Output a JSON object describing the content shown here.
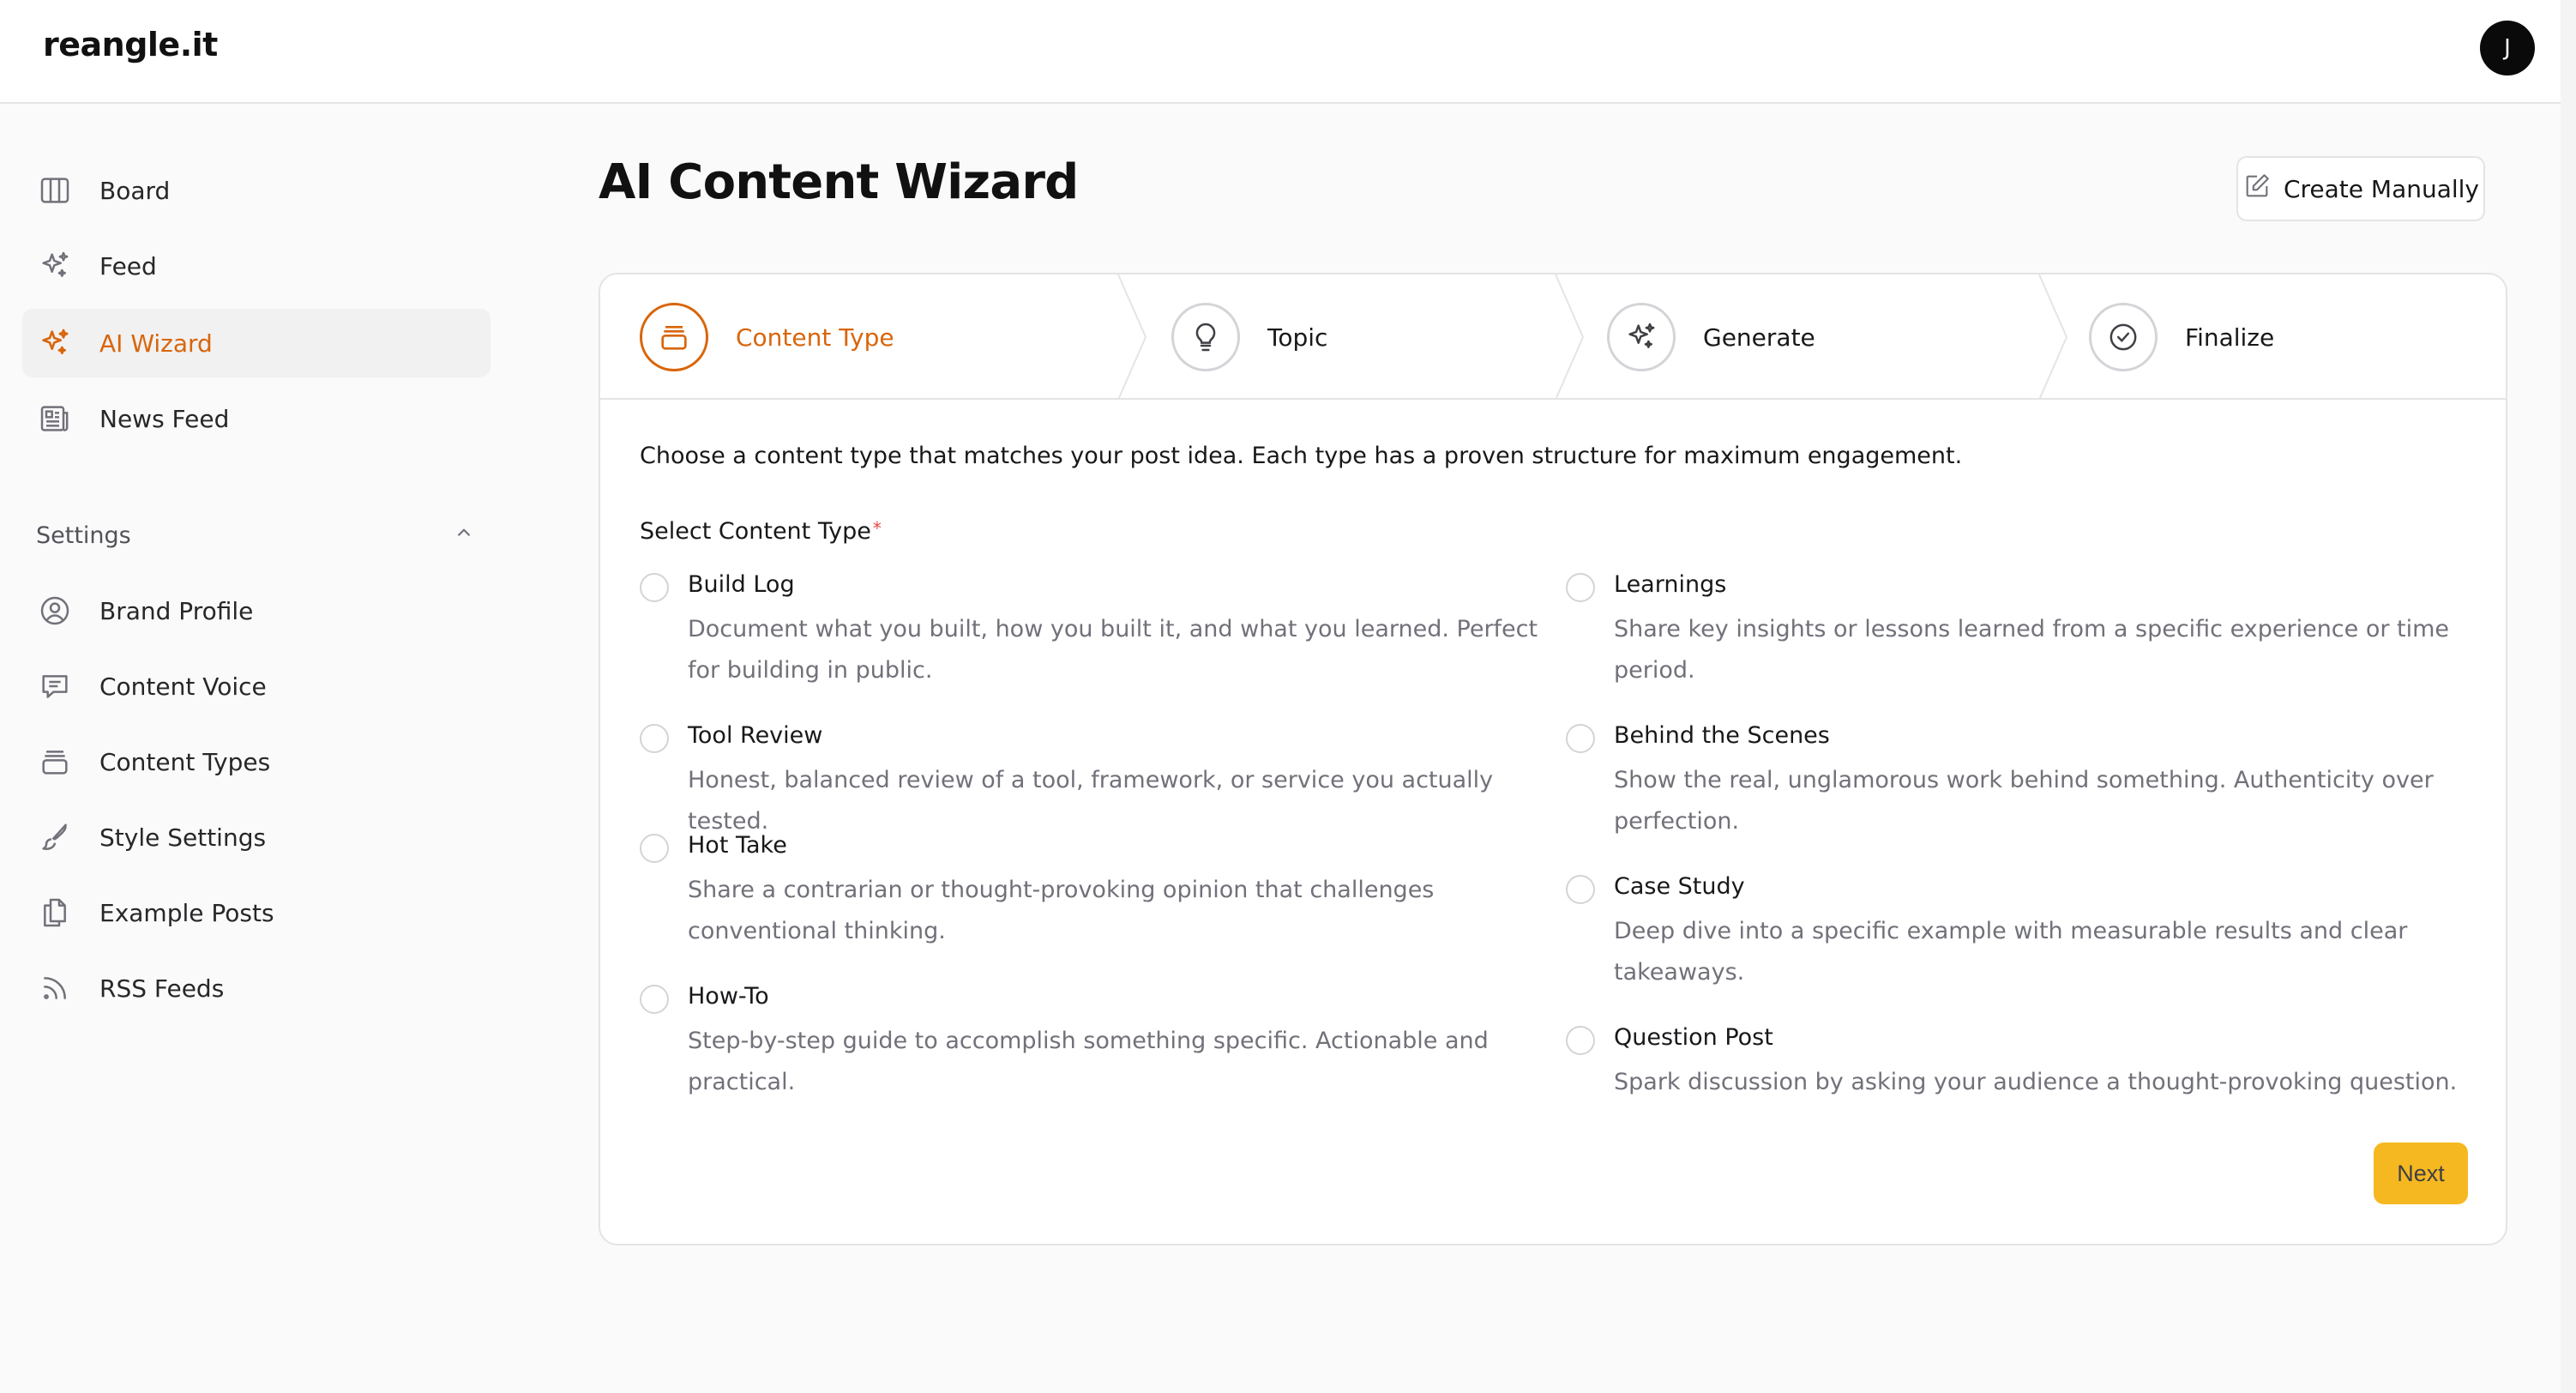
{
  "app": {
    "logo": "reangle.it",
    "user_initial": "J"
  },
  "sidebar": {
    "items": [
      {
        "label": "Board",
        "icon": "board-icon"
      },
      {
        "label": "Feed",
        "icon": "sparkles-icon"
      },
      {
        "label": "AI Wizard",
        "icon": "sparkles-icon",
        "active": true
      },
      {
        "label": "News Feed",
        "icon": "newspaper-icon"
      }
    ],
    "settings_label": "Settings",
    "settings_items": [
      {
        "label": "Brand Profile",
        "icon": "user-circle-icon"
      },
      {
        "label": "Content Voice",
        "icon": "message-icon"
      },
      {
        "label": "Content Types",
        "icon": "archive-icon"
      },
      {
        "label": "Style Settings",
        "icon": "brush-icon"
      },
      {
        "label": "Example Posts",
        "icon": "files-icon"
      },
      {
        "label": "RSS Feeds",
        "icon": "rss-icon"
      }
    ]
  },
  "main": {
    "title": "AI Content Wizard",
    "create_manually": "Create Manually",
    "steps": [
      {
        "label": "Content Type",
        "icon": "archive-icon",
        "active": true
      },
      {
        "label": "Topic",
        "icon": "lightbulb-icon"
      },
      {
        "label": "Generate",
        "icon": "sparkles-icon"
      },
      {
        "label": "Finalize",
        "icon": "check-circle-icon"
      }
    ],
    "intro": "Choose a content type that matches your post idea. Each type has a proven structure for maximum engagement.",
    "field_label": "Select Content Type",
    "required_mark": "*",
    "options": [
      {
        "title": "Build Log",
        "desc": "Document what you built, how you built it, and what you learned. Perfect for building in public."
      },
      {
        "title": "Learnings",
        "desc": "Share key insights or lessons learned from a specific experience or time period."
      },
      {
        "title": "Tool Review",
        "desc": "Honest, balanced review of a tool, framework, or service you actually tested."
      },
      {
        "title": "Behind the Scenes",
        "desc": "Show the real, unglamorous work behind something. Authenticity over perfection."
      },
      {
        "title": "Hot Take",
        "desc": "Share a contrarian or thought-provoking opinion that challenges conventional thinking."
      },
      {
        "title": "Case Study",
        "desc": "Deep dive into a specific example with measurable results and clear takeaways."
      },
      {
        "title": "How-To",
        "desc": "Step-by-step guide to accomplish something specific. Actionable and practical."
      },
      {
        "title": "Question Post",
        "desc": "Spark discussion by asking your audience a thought-provoking question."
      }
    ],
    "next_label": "Next"
  },
  "colors": {
    "accent": "#d9650a",
    "next_button": "#f5b820",
    "active_nav_bg": "#f1f1f2"
  }
}
